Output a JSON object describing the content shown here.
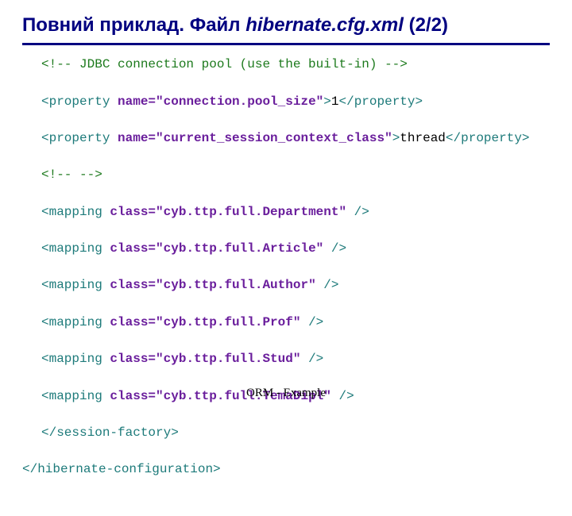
{
  "title": {
    "prefix": "Повний приклад. Файл ",
    "filename": "hibernate.cfg.xml",
    "suffix": " (2/2)"
  },
  "code": {
    "l1_comment": "<!-- JDBC connection pool (use the built-in) -->",
    "l2": {
      "open": "<property ",
      "attr": "name=",
      "val": "\"connection.pool_size\"",
      "close1": ">",
      "text": "1",
      "close2": "</property>"
    },
    "l3": {
      "open": "<property ",
      "attr": "name=",
      "val": "\"current_session_context_class\"",
      "close1": ">",
      "text": "thread",
      "close2": "</property>"
    },
    "l4_comment": "<!-- -->",
    "map_open": "<mapping ",
    "map_attr": "class=",
    "map_close": " />",
    "m1": "\"cyb.ttp.full.Department\"",
    "m2": "\"cyb.ttp.full.Article\"",
    "m3": "\"cyb.ttp.full.Author\"",
    "m4": "\"cyb.ttp.full.Prof\"",
    "m5": "\"cyb.ttp.full.Stud\"",
    "m6": "\"cyb.ttp.full.TemaDipl\"",
    "close1": "</session-factory>",
    "close2": "</hibernate-configuration>"
  },
  "footer": "ORM - Example"
}
